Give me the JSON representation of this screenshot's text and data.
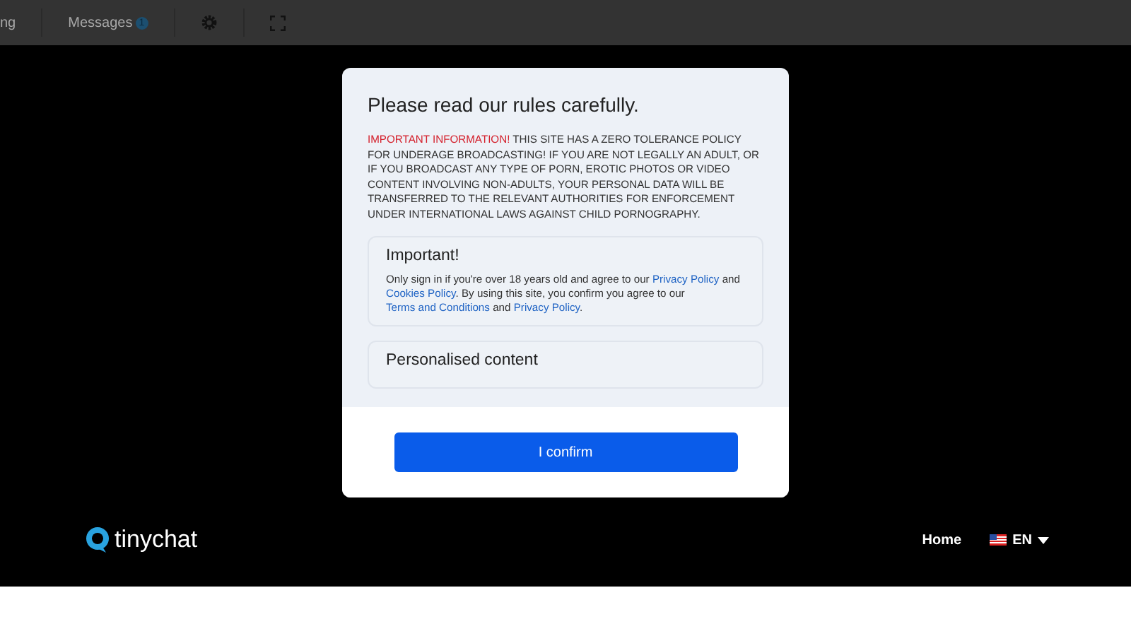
{
  "top_bar": {
    "tab_label": "ng",
    "messages": {
      "label": "Messages",
      "badge": "1"
    }
  },
  "modal": {
    "title": "Please read our rules carefully.",
    "warning": [
      {
        "text": "IMPORTANT INFORMATION!",
        "kind": "alert"
      },
      {
        "text": " THIS SITE HAS A ZERO TOLERANCE POLICY FOR UNDERAGE BROADCASTING! IF YOU ARE NOT LEGALLY AN ADULT, OR IF YOU BROADCAST ANY TYPE OF PORN, EROTIC PHOTOS OR VIDEO CONTENT INVOLVING NON-ADULTS, YOUR PERSONAL DATA WILL BE TRANSFERRED TO THE RELEVANT AUTHORITIES FOR ENFORCEMENT UNDER INTERNATIONAL LAWS AGAINST CHILD PORNOGRAPHY.",
        "kind": "plain"
      }
    ],
    "sections": [
      {
        "title": "Important!",
        "body": [
          {
            "text": "Only sign in if you're over 18 years old and agree to our ",
            "kind": "plain"
          },
          {
            "text": "Privacy Policy",
            "kind": "link"
          },
          {
            "text": " and ",
            "kind": "plain"
          },
          {
            "text": "Cookies Policy",
            "kind": "link"
          },
          {
            "text": ". By using this site, you confirm you agree to our ",
            "kind": "plain"
          },
          {
            "text": "Terms and Conditions",
            "kind": "link"
          },
          {
            "text": " and ",
            "kind": "plain"
          },
          {
            "text": "Privacy Policy",
            "kind": "link"
          },
          {
            "text": ".",
            "kind": "plain"
          }
        ]
      },
      {
        "title": "Personalised content"
      }
    ],
    "confirm_button": "I confirm"
  },
  "footer": {
    "logo": "tinychat",
    "nav": "Home",
    "language": "EN"
  }
}
